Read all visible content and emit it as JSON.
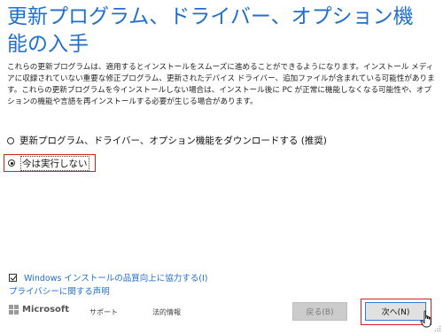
{
  "title": "更新プログラム、ドライバー、オプション機能の入手",
  "description": "これらの更新プログラムは、適用するとインストールをスムーズに進めることができるようになります。インストール メディアに収録されていない重要な修正プログラム、更新されたデバイス ドライバー、追加ファイルが含まれている可能性があります。これらの更新プログラムを今インストールしない場合は、インストール後に PC が正常に機能しなくなる可能性や、オプションの機能や言語を再インストールする必要が生じる場合があります。",
  "options": [
    {
      "label": "更新プログラム、ドライバー、オプション機能をダウンロードする (推奨)",
      "selected": false
    },
    {
      "label": "今は実行しない",
      "selected": true
    }
  ],
  "checkbox": {
    "label": "Windows インストールの品質向上に協力する(I)",
    "checked": true
  },
  "privacy_link": "プライバシーに関する声明",
  "footer": {
    "brand": "Microsoft",
    "support": "サポート",
    "legal": "法的情報",
    "back_button": "戻る(B)",
    "next_button": "次へ(N)"
  },
  "colors": {
    "title": "#1f6fcc",
    "highlight": "#d32020",
    "focus_border": "#3a78d4"
  }
}
